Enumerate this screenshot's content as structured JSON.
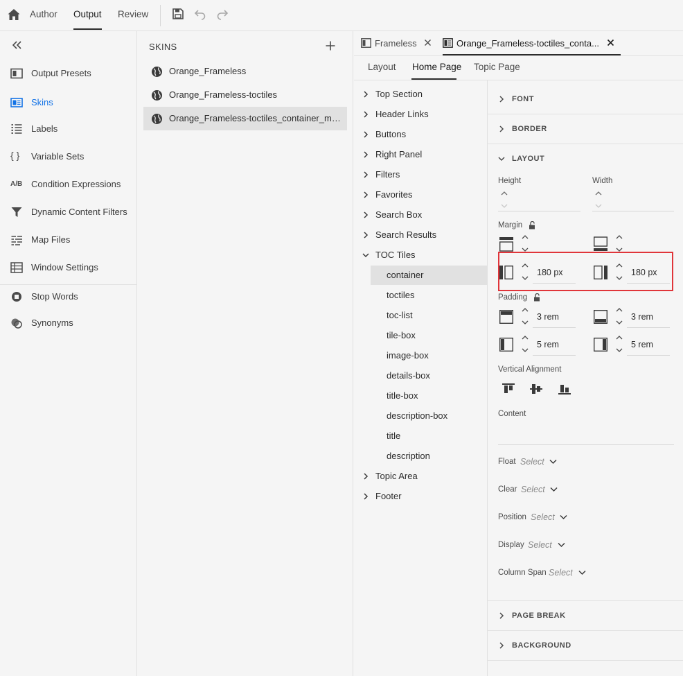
{
  "topbar": {
    "tabs": [
      "Author",
      "Output",
      "Review"
    ],
    "active_tab": "Output"
  },
  "leftnav": {
    "items": [
      {
        "label": "Output Presets",
        "icon": "output-presets-icon"
      },
      {
        "label": "Skins",
        "icon": "skins-icon",
        "active": true
      },
      {
        "label": "Labels",
        "icon": "labels-icon"
      },
      {
        "label": "Variable Sets",
        "icon": "braces-icon"
      },
      {
        "label": "Condition Expressions",
        "icon": "ab-icon"
      },
      {
        "label": "Dynamic Content Filters",
        "icon": "filter-icon"
      },
      {
        "label": "Map Files",
        "icon": "map-files-icon"
      },
      {
        "label": "Window Settings",
        "icon": "table-icon"
      },
      {
        "label": "Stop Words",
        "icon": "stop-icon"
      },
      {
        "label": "Synonyms",
        "icon": "synonyms-icon"
      }
    ],
    "ab_glyph": "A/B",
    "braces_glyph": "{ }"
  },
  "skins": {
    "title": "SKINS",
    "items": [
      "Orange_Frameless",
      "Orange_Frameless-toctiles",
      "Orange_Frameless-toctiles_container_mar..."
    ]
  },
  "editor": {
    "doc_tabs": [
      "Frameless",
      "Orange_Frameless-toctiles_conta..."
    ],
    "sub_tabs": [
      "Layout",
      "Home Page",
      "Topic Page"
    ],
    "active_sub_tab": "Home Page",
    "tree": {
      "top_items_before": [
        "Top Section",
        "Header Links",
        "Buttons",
        "Right Panel",
        "Filters",
        "Favorites",
        "Search Box",
        "Search Results"
      ],
      "expanded_item": "TOC Tiles",
      "children": [
        "container",
        "toctiles",
        "toc-list",
        "tile-box",
        "image-box",
        "details-box",
        "title-box",
        "description-box",
        "title",
        "description"
      ],
      "top_items_after": [
        "Topic Area",
        "Footer"
      ]
    },
    "properties": {
      "sections_collapsed_top": [
        "FONT",
        "BORDER"
      ],
      "layout_section": "LAYOUT",
      "height_label": "Height",
      "width_label": "Width",
      "margin_label": "Margin",
      "margin_left": "180 px",
      "margin_right": "180 px",
      "padding_label": "Padding",
      "padding_top": "3 rem",
      "padding_bottom": "3 rem",
      "padding_left": "5 rem",
      "padding_right": "5 rem",
      "vertical_alignment_label": "Vertical Alignment",
      "content_label": "Content",
      "selects": [
        {
          "label": "Float",
          "placeholder": "Select"
        },
        {
          "label": "Clear",
          "placeholder": "Select"
        },
        {
          "label": "Position",
          "placeholder": "Select"
        },
        {
          "label": "Display",
          "placeholder": "Select"
        },
        {
          "label": "Column Span",
          "placeholder": "Select"
        }
      ],
      "sections_collapsed_bottom": [
        "PAGE BREAK",
        "BACKGROUND"
      ]
    }
  },
  "colors": {
    "accent": "#1473e6",
    "highlight": "#e0353a"
  }
}
